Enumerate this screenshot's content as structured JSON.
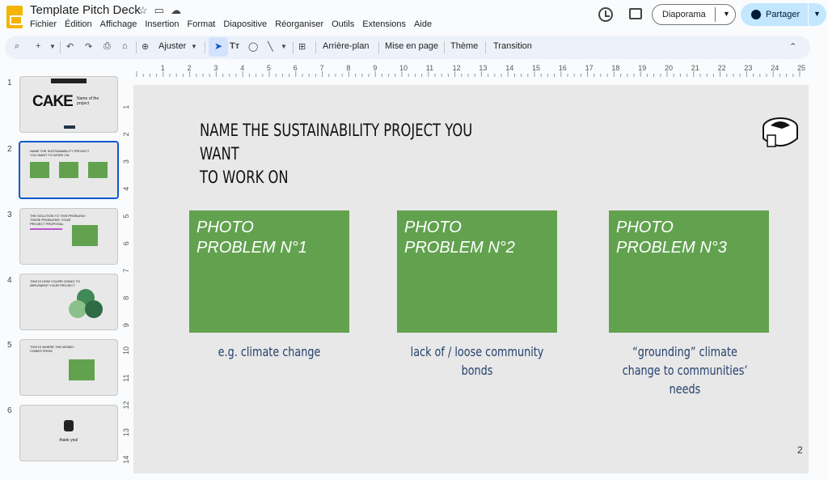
{
  "app": {
    "title": "Template Pitch Deck",
    "menu": [
      "Fichier",
      "Édition",
      "Affichage",
      "Insertion",
      "Format",
      "Diapositive",
      "Réorganiser",
      "Outils",
      "Extensions",
      "Aide"
    ],
    "slideshow_label": "Diaporama",
    "share_label": "Partager"
  },
  "toolbar": {
    "zoom_label": "Ajuster",
    "background_label": "Arrière-plan",
    "layout_label": "Mise en page",
    "theme_label": "Thème",
    "transition_label": "Transition"
  },
  "ruler": {
    "horizontal": [
      "1",
      "2",
      "3",
      "4",
      "5",
      "6",
      "7",
      "8",
      "9",
      "10",
      "11",
      "12",
      "13",
      "14",
      "15",
      "16",
      "17",
      "18",
      "19",
      "20",
      "21",
      "22",
      "23",
      "24",
      "25"
    ],
    "vertical": [
      "1",
      "2",
      "3",
      "4",
      "5",
      "6",
      "7",
      "8",
      "9",
      "10",
      "11",
      "12",
      "13",
      "14"
    ]
  },
  "thumbnails": [
    {
      "num": "1",
      "title": "CAKE",
      "subtitle": "Name of the project"
    },
    {
      "num": "2",
      "title": "NAME THE SUSTAINABILITY PROJECT YOU WANT TO WORK ON"
    },
    {
      "num": "3",
      "title": "THE SOLUTION TO THIS PROBLEM / THESE PROBLEMS: YOUR PROJECT PROPOSAL"
    },
    {
      "num": "4",
      "title": "THIS IS HOW YOU'RE GOING TO IMPLEMENT YOUR PROJECT"
    },
    {
      "num": "5",
      "title": "THIS IS WHERE THE MONEY COMES FROM"
    },
    {
      "num": "6",
      "title": "thank you!"
    }
  ],
  "slide": {
    "title": "NAME THE SUSTAINABILITY PROJECT YOU WANT\nTO WORK ON",
    "boxes": [
      {
        "label": "PHOTO\nPROBLEM N°1",
        "caption": "e.g. climate change"
      },
      {
        "label": "PHOTO\nPROBLEM N°2",
        "caption": "lack of / loose community bonds"
      },
      {
        "label": "PHOTO\nPROBLEM N°3",
        "caption": "“grounding” climate change to communities’ needs"
      }
    ],
    "page_number": "2",
    "box_color": "#62a24f",
    "caption_color": "#25416e"
  }
}
